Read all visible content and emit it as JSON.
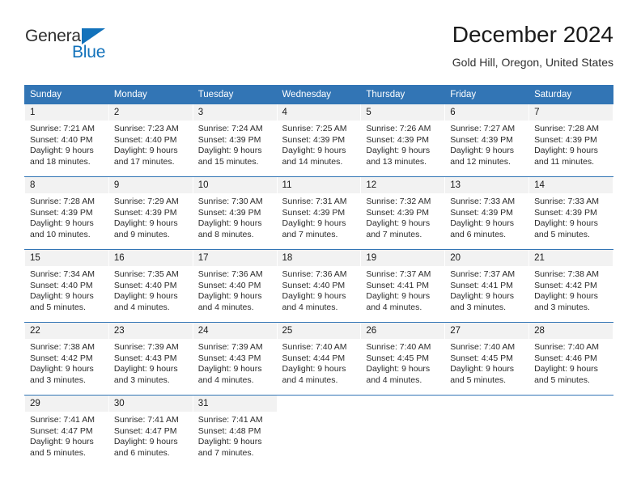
{
  "brand": {
    "name_top": "General",
    "name_bottom": "Blue",
    "triangle_icon": "triangle-icon",
    "color_dark": "#2f2f2f",
    "color_blue": "#1272bb"
  },
  "header": {
    "title": "December 2024",
    "subtitle": "Gold Hill, Oregon, United States"
  },
  "theme": {
    "header_blue": "#3275b5",
    "daynum_gray": "#f2f2f2",
    "text": "#2b2b2b"
  },
  "calendar": {
    "weekdays": [
      "Sunday",
      "Monday",
      "Tuesday",
      "Wednesday",
      "Thursday",
      "Friday",
      "Saturday"
    ],
    "weeks": [
      [
        {
          "day": "1",
          "sunrise": "Sunrise: 7:21 AM",
          "sunset": "Sunset: 4:40 PM",
          "daylight1": "Daylight: 9 hours",
          "daylight2": "and 18 minutes."
        },
        {
          "day": "2",
          "sunrise": "Sunrise: 7:23 AM",
          "sunset": "Sunset: 4:40 PM",
          "daylight1": "Daylight: 9 hours",
          "daylight2": "and 17 minutes."
        },
        {
          "day": "3",
          "sunrise": "Sunrise: 7:24 AM",
          "sunset": "Sunset: 4:39 PM",
          "daylight1": "Daylight: 9 hours",
          "daylight2": "and 15 minutes."
        },
        {
          "day": "4",
          "sunrise": "Sunrise: 7:25 AM",
          "sunset": "Sunset: 4:39 PM",
          "daylight1": "Daylight: 9 hours",
          "daylight2": "and 14 minutes."
        },
        {
          "day": "5",
          "sunrise": "Sunrise: 7:26 AM",
          "sunset": "Sunset: 4:39 PM",
          "daylight1": "Daylight: 9 hours",
          "daylight2": "and 13 minutes."
        },
        {
          "day": "6",
          "sunrise": "Sunrise: 7:27 AM",
          "sunset": "Sunset: 4:39 PM",
          "daylight1": "Daylight: 9 hours",
          "daylight2": "and 12 minutes."
        },
        {
          "day": "7",
          "sunrise": "Sunrise: 7:28 AM",
          "sunset": "Sunset: 4:39 PM",
          "daylight1": "Daylight: 9 hours",
          "daylight2": "and 11 minutes."
        }
      ],
      [
        {
          "day": "8",
          "sunrise": "Sunrise: 7:28 AM",
          "sunset": "Sunset: 4:39 PM",
          "daylight1": "Daylight: 9 hours",
          "daylight2": "and 10 minutes."
        },
        {
          "day": "9",
          "sunrise": "Sunrise: 7:29 AM",
          "sunset": "Sunset: 4:39 PM",
          "daylight1": "Daylight: 9 hours",
          "daylight2": "and 9 minutes."
        },
        {
          "day": "10",
          "sunrise": "Sunrise: 7:30 AM",
          "sunset": "Sunset: 4:39 PM",
          "daylight1": "Daylight: 9 hours",
          "daylight2": "and 8 minutes."
        },
        {
          "day": "11",
          "sunrise": "Sunrise: 7:31 AM",
          "sunset": "Sunset: 4:39 PM",
          "daylight1": "Daylight: 9 hours",
          "daylight2": "and 7 minutes."
        },
        {
          "day": "12",
          "sunrise": "Sunrise: 7:32 AM",
          "sunset": "Sunset: 4:39 PM",
          "daylight1": "Daylight: 9 hours",
          "daylight2": "and 7 minutes."
        },
        {
          "day": "13",
          "sunrise": "Sunrise: 7:33 AM",
          "sunset": "Sunset: 4:39 PM",
          "daylight1": "Daylight: 9 hours",
          "daylight2": "and 6 minutes."
        },
        {
          "day": "14",
          "sunrise": "Sunrise: 7:33 AM",
          "sunset": "Sunset: 4:39 PM",
          "daylight1": "Daylight: 9 hours",
          "daylight2": "and 5 minutes."
        }
      ],
      [
        {
          "day": "15",
          "sunrise": "Sunrise: 7:34 AM",
          "sunset": "Sunset: 4:40 PM",
          "daylight1": "Daylight: 9 hours",
          "daylight2": "and 5 minutes."
        },
        {
          "day": "16",
          "sunrise": "Sunrise: 7:35 AM",
          "sunset": "Sunset: 4:40 PM",
          "daylight1": "Daylight: 9 hours",
          "daylight2": "and 4 minutes."
        },
        {
          "day": "17",
          "sunrise": "Sunrise: 7:36 AM",
          "sunset": "Sunset: 4:40 PM",
          "daylight1": "Daylight: 9 hours",
          "daylight2": "and 4 minutes."
        },
        {
          "day": "18",
          "sunrise": "Sunrise: 7:36 AM",
          "sunset": "Sunset: 4:40 PM",
          "daylight1": "Daylight: 9 hours",
          "daylight2": "and 4 minutes."
        },
        {
          "day": "19",
          "sunrise": "Sunrise: 7:37 AM",
          "sunset": "Sunset: 4:41 PM",
          "daylight1": "Daylight: 9 hours",
          "daylight2": "and 4 minutes."
        },
        {
          "day": "20",
          "sunrise": "Sunrise: 7:37 AM",
          "sunset": "Sunset: 4:41 PM",
          "daylight1": "Daylight: 9 hours",
          "daylight2": "and 3 minutes."
        },
        {
          "day": "21",
          "sunrise": "Sunrise: 7:38 AM",
          "sunset": "Sunset: 4:42 PM",
          "daylight1": "Daylight: 9 hours",
          "daylight2": "and 3 minutes."
        }
      ],
      [
        {
          "day": "22",
          "sunrise": "Sunrise: 7:38 AM",
          "sunset": "Sunset: 4:42 PM",
          "daylight1": "Daylight: 9 hours",
          "daylight2": "and 3 minutes."
        },
        {
          "day": "23",
          "sunrise": "Sunrise: 7:39 AM",
          "sunset": "Sunset: 4:43 PM",
          "daylight1": "Daylight: 9 hours",
          "daylight2": "and 3 minutes."
        },
        {
          "day": "24",
          "sunrise": "Sunrise: 7:39 AM",
          "sunset": "Sunset: 4:43 PM",
          "daylight1": "Daylight: 9 hours",
          "daylight2": "and 4 minutes."
        },
        {
          "day": "25",
          "sunrise": "Sunrise: 7:40 AM",
          "sunset": "Sunset: 4:44 PM",
          "daylight1": "Daylight: 9 hours",
          "daylight2": "and 4 minutes."
        },
        {
          "day": "26",
          "sunrise": "Sunrise: 7:40 AM",
          "sunset": "Sunset: 4:45 PM",
          "daylight1": "Daylight: 9 hours",
          "daylight2": "and 4 minutes."
        },
        {
          "day": "27",
          "sunrise": "Sunrise: 7:40 AM",
          "sunset": "Sunset: 4:45 PM",
          "daylight1": "Daylight: 9 hours",
          "daylight2": "and 5 minutes."
        },
        {
          "day": "28",
          "sunrise": "Sunrise: 7:40 AM",
          "sunset": "Sunset: 4:46 PM",
          "daylight1": "Daylight: 9 hours",
          "daylight2": "and 5 minutes."
        }
      ],
      [
        {
          "day": "29",
          "sunrise": "Sunrise: 7:41 AM",
          "sunset": "Sunset: 4:47 PM",
          "daylight1": "Daylight: 9 hours",
          "daylight2": "and 5 minutes."
        },
        {
          "day": "30",
          "sunrise": "Sunrise: 7:41 AM",
          "sunset": "Sunset: 4:47 PM",
          "daylight1": "Daylight: 9 hours",
          "daylight2": "and 6 minutes."
        },
        {
          "day": "31",
          "sunrise": "Sunrise: 7:41 AM",
          "sunset": "Sunset: 4:48 PM",
          "daylight1": "Daylight: 9 hours",
          "daylight2": "and 7 minutes."
        },
        {
          "day": "",
          "sunrise": "",
          "sunset": "",
          "daylight1": "",
          "daylight2": ""
        },
        {
          "day": "",
          "sunrise": "",
          "sunset": "",
          "daylight1": "",
          "daylight2": ""
        },
        {
          "day": "",
          "sunrise": "",
          "sunset": "",
          "daylight1": "",
          "daylight2": ""
        },
        {
          "day": "",
          "sunrise": "",
          "sunset": "",
          "daylight1": "",
          "daylight2": ""
        }
      ]
    ]
  }
}
